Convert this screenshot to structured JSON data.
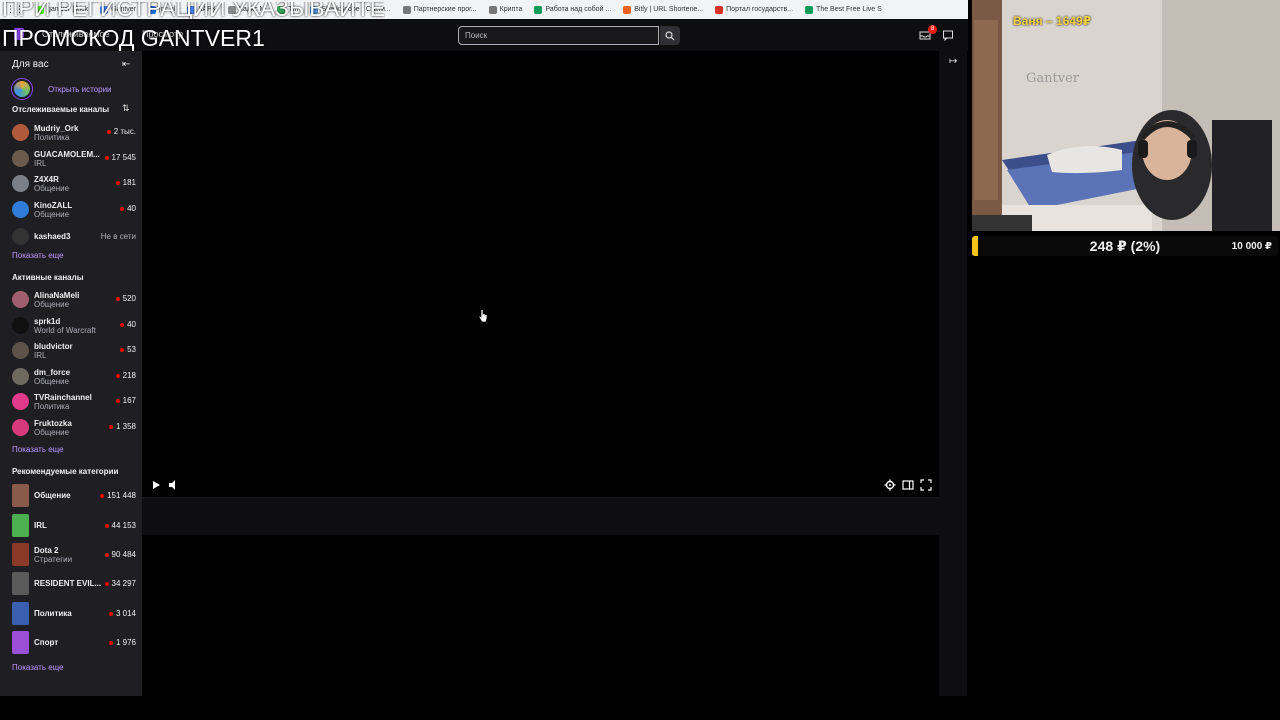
{
  "overlay": {
    "promo_line1": "ПРИ РЕГИСТРАЦИИ УКАЗЫВАЙТЕ",
    "promo_line2": "ПРОМОКОД GANTVER1"
  },
  "bookmarks": [
    {
      "label": "gantver | kick",
      "color": "#53fc18"
    },
    {
      "label": "Gantver",
      "color": "#4285f4"
    },
    {
      "label": "joc gl",
      "color": "#1a73e8"
    },
    {
      "label": "КАРК",
      "color": "#4285f4"
    },
    {
      "label": "Кадкс М",
      "color": "#888888"
    },
    {
      "label": "Tm",
      "color": "#34a853"
    },
    {
      "label": "SharkScope - Стати...",
      "color": "#4a90d9"
    },
    {
      "label": "Партнерские прог...",
      "color": "#777777"
    },
    {
      "label": "Крипта",
      "color": "#777777"
    },
    {
      "label": "Работа над собой ...",
      "color": "#0f9d58"
    },
    {
      "label": "Bitly | URL Shortene...",
      "color": "#ee6123"
    },
    {
      "label": "Портал государств...",
      "color": "#d93025"
    },
    {
      "label": "The Best Free Live S",
      "color": "#0f9d58"
    }
  ],
  "topnav": {
    "following": "Отслеживаемое",
    "browse": "Просмотр",
    "search_placeholder": "Поиск",
    "notif_count": "8"
  },
  "sidebar": {
    "header": "Для вас",
    "stories_label": "Открыть истории",
    "followed_title": "Отслеживаемые каналы",
    "followed": [
      {
        "name": "Mudriy_Ork",
        "cat": "Политика",
        "count": "2 тыс.",
        "live": true,
        "color": "#b05a3c"
      },
      {
        "name": "GUACAMOLEM...",
        "cat": "IRL",
        "count": "17 545",
        "live": true,
        "color": "#6a5b4c"
      },
      {
        "name": "Z4X4R",
        "cat": "Общение",
        "count": "181",
        "live": true,
        "color": "#7a7f88"
      },
      {
        "name": "KinoZALL",
        "cat": "Общение",
        "count": "40",
        "live": true,
        "color": "#2f7dd8"
      },
      {
        "name": "kashaed3",
        "cat": "",
        "count": "Не в сети",
        "live": false,
        "color": "#333333"
      }
    ],
    "show_more": "Показать еще",
    "active_title": "Активные каналы",
    "active": [
      {
        "name": "AlinaNaMeli",
        "cat": "Общение",
        "count": "520",
        "color": "#a05f6e"
      },
      {
        "name": "sprk1d",
        "cat": "World of Warcraft",
        "count": "40",
        "color": "#111111"
      },
      {
        "name": "bludvictor",
        "cat": "IRL",
        "count": "53",
        "color": "#5d5248"
      },
      {
        "name": "dm_force",
        "cat": "Общение",
        "count": "218",
        "color": "#6e6a60"
      },
      {
        "name": "TVRainchannel",
        "cat": "Политика",
        "count": "167",
        "color": "#e23a8a"
      },
      {
        "name": "Fruktozka",
        "cat": "Общение",
        "count": "1 358",
        "color": "#d63a7a"
      }
    ],
    "recommended_title": "Рекомендуемые категории",
    "categories": [
      {
        "name": "Общение",
        "cat": "",
        "count": "151 448",
        "color": "#8a5a4a"
      },
      {
        "name": "IRL",
        "cat": "",
        "count": "44 153",
        "color": "#4caf50"
      },
      {
        "name": "Dota 2",
        "cat": "Стратегии",
        "count": "90 484",
        "color": "#8b3a2a"
      },
      {
        "name": "RESIDENT EVIL...",
        "cat": "",
        "count": "34 297",
        "color": "#5a5a5a"
      },
      {
        "name": "Политика",
        "cat": "",
        "count": "3 014",
        "color": "#3a5fb0"
      },
      {
        "name": "Спорт",
        "cat": "",
        "count": "1 976",
        "color": "#9b4fd6"
      }
    ]
  },
  "webcam": {
    "donor": "Ваня – 1649₽",
    "wall_text": "Gantver"
  },
  "goal": {
    "current": "248 ₽ (2%)",
    "total": "10 000 ₽",
    "progress": 0.02,
    "fill_color": "#f5c518"
  }
}
